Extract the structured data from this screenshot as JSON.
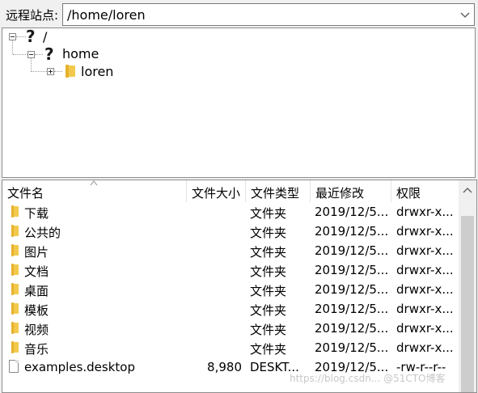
{
  "remote_site": {
    "label": "远程站点:",
    "path": "/home/loren"
  },
  "tree": {
    "root_label": "/",
    "home_label": "home",
    "loren_label": "loren"
  },
  "columns": [
    "文件名",
    "文件大小",
    "文件类型",
    "最近修改",
    "权限"
  ],
  "files": [
    {
      "name": "下载",
      "size": "",
      "type": "文件夹",
      "modified": "2019/12/5...",
      "perms": "drwxr-x...",
      "icon": "folder-icon"
    },
    {
      "name": "公共的",
      "size": "",
      "type": "文件夹",
      "modified": "2019/12/5...",
      "perms": "drwxr-x...",
      "icon": "folder-icon"
    },
    {
      "name": "图片",
      "size": "",
      "type": "文件夹",
      "modified": "2019/12/5...",
      "perms": "drwxr-x...",
      "icon": "folder-icon"
    },
    {
      "name": "文档",
      "size": "",
      "type": "文件夹",
      "modified": "2019/12/5...",
      "perms": "drwxr-x...",
      "icon": "folder-icon"
    },
    {
      "name": "桌面",
      "size": "",
      "type": "文件夹",
      "modified": "2019/12/5...",
      "perms": "drwxr-x...",
      "icon": "folder-icon"
    },
    {
      "name": "模板",
      "size": "",
      "type": "文件夹",
      "modified": "2019/12/5...",
      "perms": "drwxr-x...",
      "icon": "folder-icon"
    },
    {
      "name": "视频",
      "size": "",
      "type": "文件夹",
      "modified": "2019/12/5...",
      "perms": "drwxr-x...",
      "icon": "folder-icon"
    },
    {
      "name": "音乐",
      "size": "",
      "type": "文件夹",
      "modified": "2019/12/5...",
      "perms": "drwxr-x...",
      "icon": "folder-icon"
    },
    {
      "name": "examples.desktop",
      "size": "8,980",
      "type": "DESKT...",
      "modified": "2019/12/5...",
      "perms": "-rw-r--r--",
      "icon": "file-icon"
    }
  ],
  "watermark": "https://blog.csdn... @51CTO博客",
  "colors": {
    "folder": "#f2c94c",
    "selection": "#ffffff"
  }
}
